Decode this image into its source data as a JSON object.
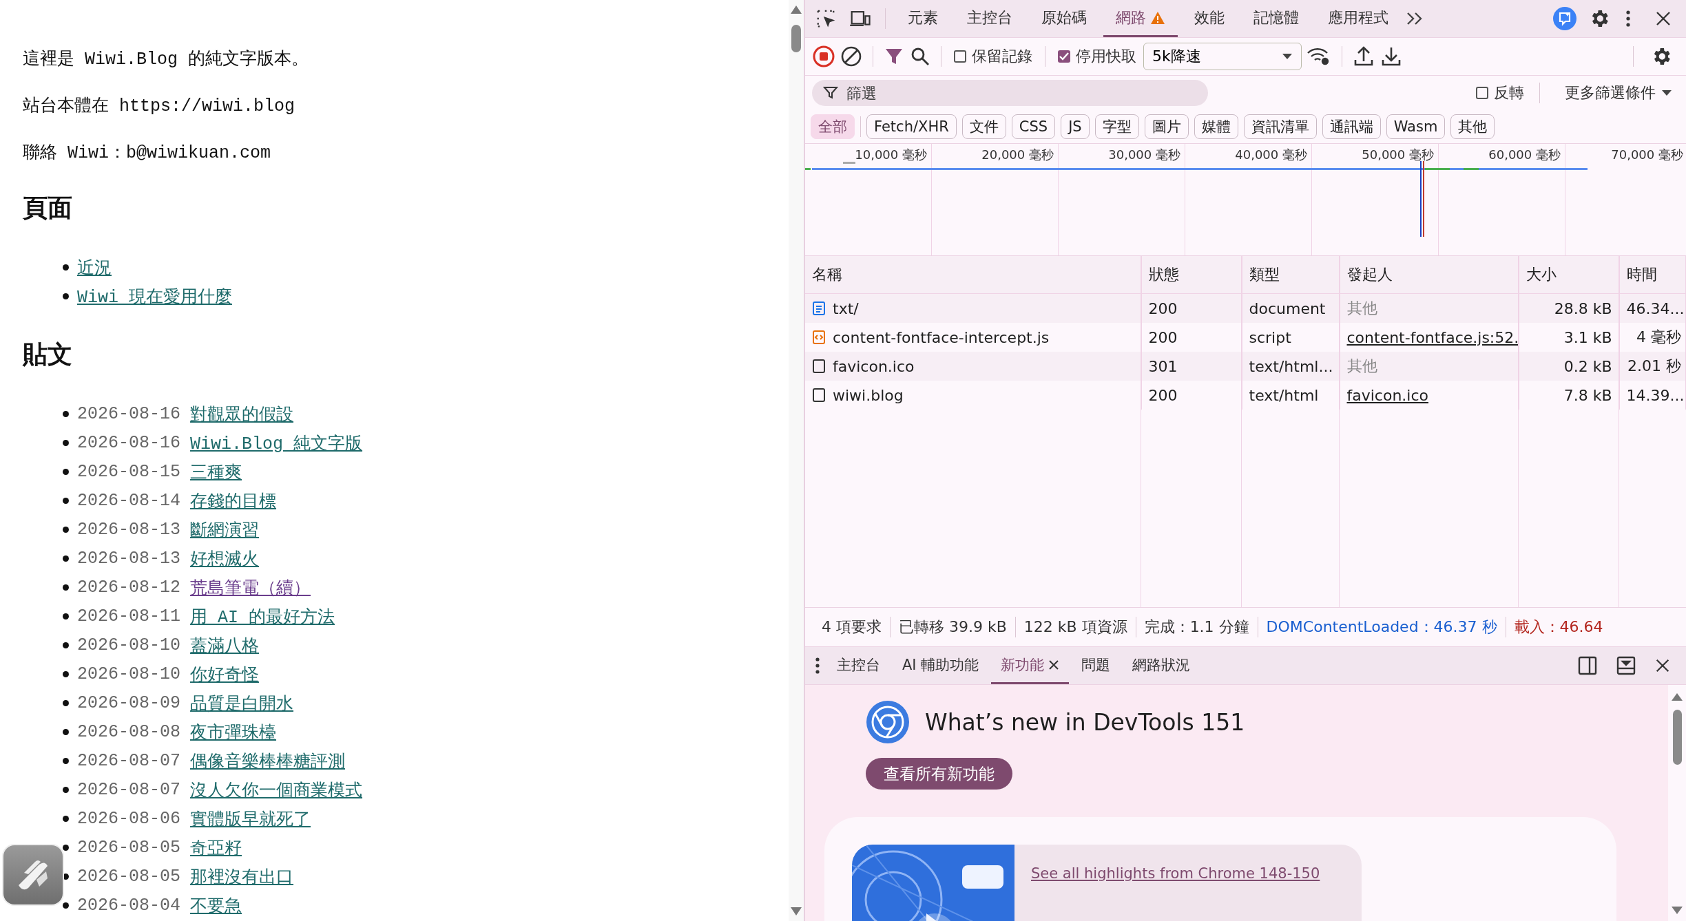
{
  "page": {
    "intro": [
      "這裡是 Wiwi.Blog 的純文字版本。",
      "站台本體在 https://wiwi.blog",
      "聯絡 Wiwi：b@wiwikuan.com"
    ],
    "sections": [
      {
        "heading": "頁面",
        "items": [
          {
            "title": "近況",
            "visited": false
          },
          {
            "title": "Wiwi 現在愛用什麼",
            "visited": false
          }
        ]
      },
      {
        "heading": "貼文",
        "items": [
          {
            "date": "2026-08-16",
            "title": "對觀眾的假設",
            "visited": false
          },
          {
            "date": "2026-08-16",
            "title": "Wiwi.Blog 純文字版",
            "visited": false
          },
          {
            "date": "2026-08-15",
            "title": "三種爽",
            "visited": false
          },
          {
            "date": "2026-08-14",
            "title": "存錢的目標",
            "visited": false
          },
          {
            "date": "2026-08-13",
            "title": "斷網演習",
            "visited": false
          },
          {
            "date": "2026-08-13",
            "title": "好想滅火",
            "visited": false
          },
          {
            "date": "2026-08-12",
            "title": "荒島筆電（續）",
            "visited": true
          },
          {
            "date": "2026-08-11",
            "title": "用 AI 的最好方法",
            "visited": false
          },
          {
            "date": "2026-08-10",
            "title": "蓋滿八格",
            "visited": false
          },
          {
            "date": "2026-08-10",
            "title": "你好奇怪",
            "visited": false
          },
          {
            "date": "2026-08-09",
            "title": "品質是白開水",
            "visited": false
          },
          {
            "date": "2026-08-08",
            "title": "夜市彈珠檯",
            "visited": false
          },
          {
            "date": "2026-08-07",
            "title": "偶像音樂棒棒糖評測",
            "visited": false
          },
          {
            "date": "2026-08-07",
            "title": "沒人欠你一個商業模式",
            "visited": false
          },
          {
            "date": "2026-08-06",
            "title": "實體版早就死了",
            "visited": false
          },
          {
            "date": "2026-08-05",
            "title": "奇亞籽",
            "visited": false
          },
          {
            "date": "2026-08-05",
            "title": "那裡沒有出口",
            "visited": false
          },
          {
            "date": "2026-08-04",
            "title": "不要急",
            "visited": false
          }
        ]
      }
    ]
  },
  "devtools": {
    "tabs": [
      {
        "label": "元素",
        "selected": false,
        "warning": false
      },
      {
        "label": "主控台",
        "selected": false,
        "warning": false
      },
      {
        "label": "原始碼",
        "selected": false,
        "warning": false
      },
      {
        "label": "網路",
        "selected": true,
        "warning": true
      },
      {
        "label": "效能",
        "selected": false,
        "warning": false
      },
      {
        "label": "記憶體",
        "selected": false,
        "warning": false
      },
      {
        "label": "應用程式",
        "selected": false,
        "warning": false
      }
    ],
    "toolbar": {
      "recording": true,
      "preserve_log": {
        "label": "保留記錄",
        "checked": false
      },
      "disable_cache": {
        "label": "停用快取",
        "checked": true
      },
      "throttling": "5k降速"
    },
    "filter": {
      "placeholder": "篩選",
      "invert": {
        "label": "反轉",
        "checked": false
      },
      "more": "更多篩選條件"
    },
    "type_filters": [
      {
        "label": "全部",
        "selected": true
      },
      {
        "label": "Fetch/XHR",
        "selected": false
      },
      {
        "label": "文件",
        "selected": false
      },
      {
        "label": "CSS",
        "selected": false
      },
      {
        "label": "JS",
        "selected": false
      },
      {
        "label": "字型",
        "selected": false
      },
      {
        "label": "圖片",
        "selected": false
      },
      {
        "label": "媒體",
        "selected": false
      },
      {
        "label": "資訊清單",
        "selected": false
      },
      {
        "label": "通訊端",
        "selected": false
      },
      {
        "label": "Wasm",
        "selected": false
      },
      {
        "label": "其他",
        "selected": false
      }
    ],
    "timeline_ticks": [
      "10,000 毫秒",
      "20,000 毫秒",
      "30,000 毫秒",
      "40,000 毫秒",
      "50,000 毫秒",
      "60,000 毫秒",
      "70,000 毫秒"
    ],
    "columns": [
      "名稱",
      "狀態",
      "類型",
      "發起人",
      "大小",
      "時間"
    ],
    "rows": [
      {
        "kind": "document",
        "name": "txt/",
        "status": "200",
        "type": "document",
        "initiator": "其他",
        "initiator_link": false,
        "size": "28.8 kB",
        "time": "46.34..."
      },
      {
        "kind": "script",
        "name": "content-fontface-intercept.js",
        "status": "200",
        "type": "script",
        "initiator": "content-fontface.js:52.",
        "initiator_link": true,
        "size": "3.1 kB",
        "time": "4 毫秒"
      },
      {
        "kind": "other",
        "name": "favicon.ico",
        "status": "301",
        "type": "text/html...",
        "initiator": "其他",
        "initiator_link": false,
        "size": "0.2 kB",
        "time": "2.01 秒"
      },
      {
        "kind": "other",
        "name": "wiwi.blog",
        "status": "200",
        "type": "text/html",
        "initiator": "favicon.ico",
        "initiator_link": true,
        "size": "7.8 kB",
        "time": "14.39..."
      }
    ],
    "summary": [
      {
        "text": "4 項要求",
        "color": "#333333"
      },
      {
        "text": "已轉移 39.9 kB",
        "color": "#333333"
      },
      {
        "text": "122 kB 項資源",
        "color": "#333333"
      },
      {
        "text": "完成：1.1 分鐘",
        "color": "#333333"
      },
      {
        "text": "DOMContentLoaded：46.37 秒",
        "color": "#1a5fd0"
      },
      {
        "text": "載入：46.64",
        "color": "#b3261e"
      }
    ],
    "drawer_tabs": [
      {
        "label": "主控台",
        "selected": false,
        "closable": false
      },
      {
        "label": "AI 輔助功能",
        "selected": false,
        "closable": false
      },
      {
        "label": "新功能",
        "selected": true,
        "closable": true
      },
      {
        "label": "問題",
        "selected": false,
        "closable": false
      },
      {
        "label": "網路狀況",
        "selected": false,
        "closable": false
      }
    ],
    "whats_new": {
      "title": "What’s new in DevTools 151",
      "button": "查看所有新功能",
      "highlight_link": "See all highlights from Chrome 148-150"
    }
  }
}
